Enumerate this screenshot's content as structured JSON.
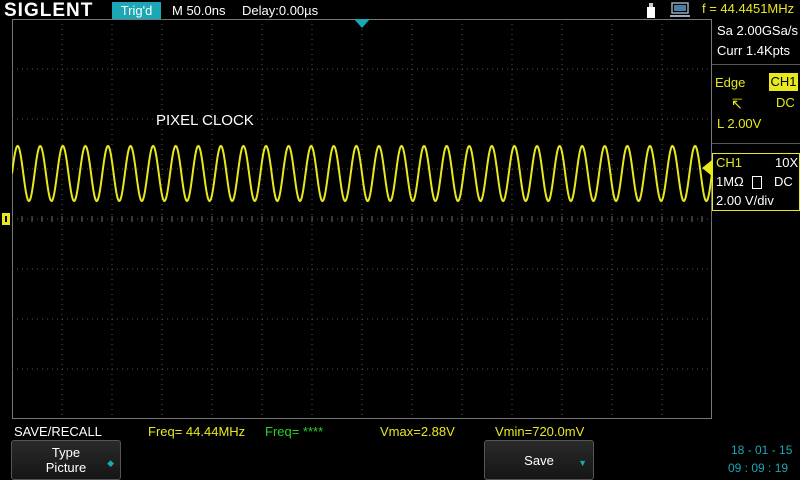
{
  "topbar": {
    "brand": "SIGLENT",
    "trig_status": "Trig'd",
    "timebase": "M 50.0ns",
    "delay": "Delay:0.00µs",
    "frequency": "f = 44.4451MHz",
    "icons": [
      "usb-icon",
      "network-icon"
    ]
  },
  "acquisition": {
    "sample_rate": "Sa 2.00GSa/s",
    "memory": "Curr 1.4Kpts"
  },
  "trigger": {
    "type": "Edge",
    "source": "CH1",
    "slope_icon": "rising-edge-icon",
    "coupling": "DC",
    "level": "L  2.00V"
  },
  "channel": {
    "name": "CH1",
    "probe": "10X",
    "impedance": "1MΩ",
    "coupling": "DC",
    "vdiv": "2.00 V/div"
  },
  "waveform": {
    "label": "PIXEL CLOCK",
    "color": "#e8e81e",
    "cycles_on_screen": 31
  },
  "measurements": {
    "menu_title": "SAVE/RECALL",
    "freq1": "Freq= 44.44MHz",
    "freq2": "Freq= ****",
    "vmax": "Vmax=2.88V",
    "vmin": "Vmin=720.0mV"
  },
  "softkeys": {
    "type_line1": "Type",
    "type_line2": "Picture",
    "save_label": "Save"
  },
  "clock": {
    "date": "18 - 01 - 15",
    "time": "09 : 09 : 19"
  },
  "colors": {
    "accent": "#1ba7b6",
    "ch1": "#e8e81e",
    "freq2": "#27d327"
  }
}
